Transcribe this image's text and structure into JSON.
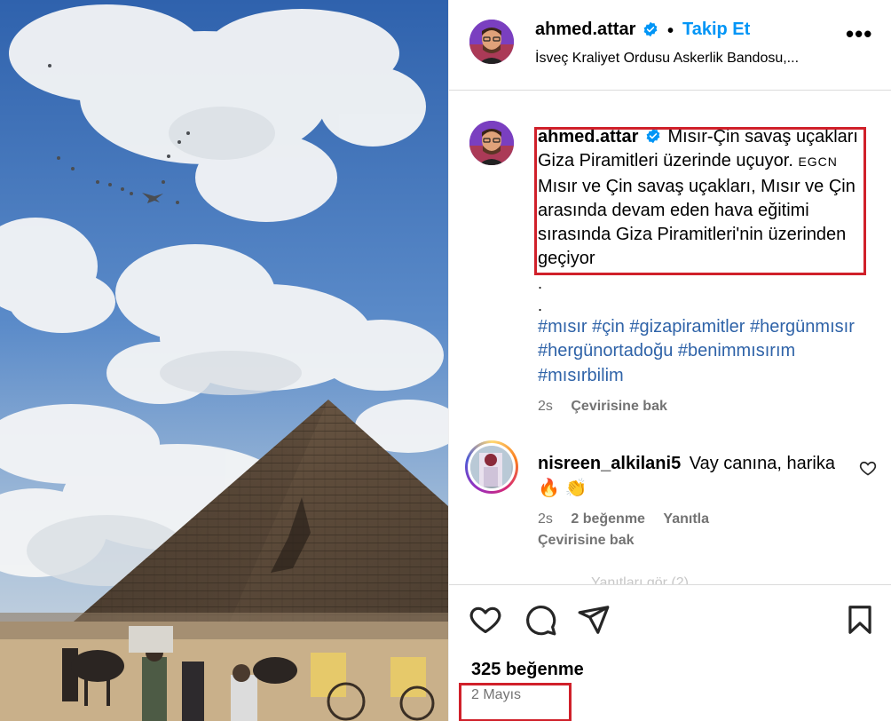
{
  "post": {
    "username": "ahmed.attar",
    "follow_label": "Takip Et",
    "separator": "•",
    "more_label": "•••",
    "location": "İsveç Kraliyet Ordusu Askerlik Bandosu,..."
  },
  "caption": {
    "username": "ahmed.attar",
    "text_line1": "Mısır-Çin savaş uçakları Giza Piramitleri üzerinde uçuyor.",
    "tag": "EGCN",
    "text_rest": "Mısır ve Çin savaş uçakları, Mısır ve Çin arasında devam eden hava eğitimi sırasında Giza Piramitleri'nin üzerinden geçiyor",
    "dot1": ".",
    "dot2": ".",
    "hashtags": [
      "#mısır",
      "#çin",
      "#gizapiramitler",
      "#hergünmısır",
      "#hergünortadoğu",
      "#benimmısırım",
      "#mısırbilim"
    ],
    "time": "2s",
    "translate_label": "Çevirisine bak"
  },
  "comment": {
    "username": "nisreen_alkilani5",
    "text": "Vay canına, harika",
    "emoji": "🔥 👏",
    "time": "2s",
    "likes": "2 beğenme",
    "reply_label": "Yanıtla",
    "translate_label": "Çevirisine bak",
    "faded_text": "Yanıtları gör (2)"
  },
  "footer": {
    "likes": "325 beğenme",
    "date": "2 Mayıs"
  },
  "colors": {
    "link": "#0095f6",
    "hashtag": "#2f63a8",
    "highlight": "#d0202a",
    "muted": "#737373"
  },
  "icons": [
    "verified-badge-icon",
    "more-icon",
    "heart-icon",
    "comment-icon",
    "share-icon",
    "bookmark-icon"
  ]
}
